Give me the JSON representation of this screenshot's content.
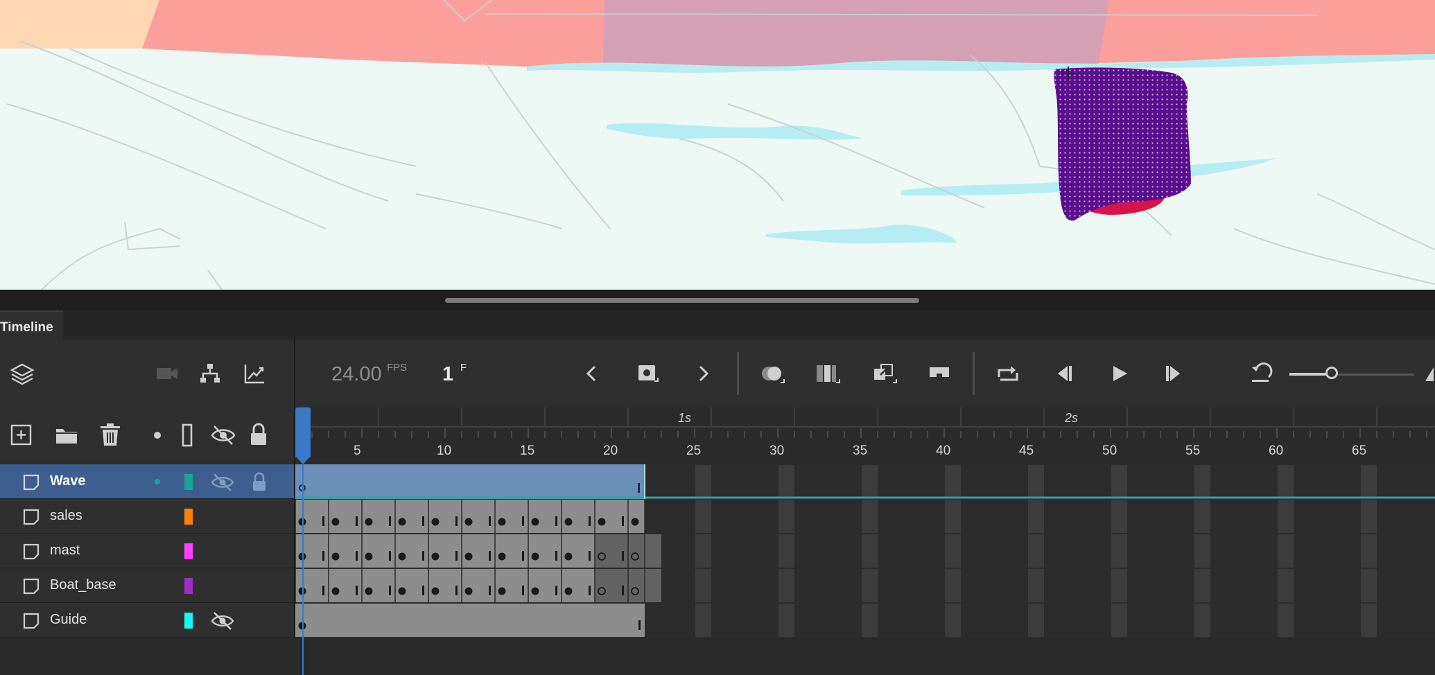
{
  "panel": {
    "tab_label": "Timeline"
  },
  "playback": {
    "fps_value": "24.00",
    "fps_unit": "FPS",
    "frame_value": "1",
    "frame_unit": "F"
  },
  "ruler": {
    "frame_labels": [
      "5",
      "10",
      "15",
      "20",
      "25",
      "30",
      "35",
      "40",
      "45",
      "50",
      "55",
      "60",
      "65"
    ],
    "second_labels": [
      "1s",
      "2s"
    ]
  },
  "layers": [
    {
      "name": "Wave",
      "color": "#1aa39a",
      "selected": true,
      "hidden": true,
      "locked": true
    },
    {
      "name": "sales",
      "color": "#ff7f0e",
      "selected": false,
      "hidden": false,
      "locked": false
    },
    {
      "name": "mast",
      "color": "#ff40ff",
      "selected": false,
      "hidden": false,
      "locked": false
    },
    {
      "name": "Boat_base",
      "color": "#9b30c8",
      "selected": false,
      "hidden": false,
      "locked": false
    },
    {
      "name": "Guide",
      "color": "#19f5f0",
      "selected": false,
      "hidden": true,
      "locked": false
    }
  ],
  "icons": {
    "layer_panel": "layers-icon",
    "camera": "camera-icon",
    "parenting": "layer-parenting-icon",
    "graph": "graph-icon",
    "add_layer": "add-layer-icon",
    "add_folder": "folder-icon",
    "delete_layer": "trash-icon",
    "highlight": "dot-icon",
    "outline": "outline-icon",
    "visibility": "eye-hidden-icon",
    "lock": "lock-icon"
  },
  "colors": {
    "accent": "#3b79c9",
    "selected_row": "#3c5f8f",
    "frame_span": "#8d8d8d"
  }
}
